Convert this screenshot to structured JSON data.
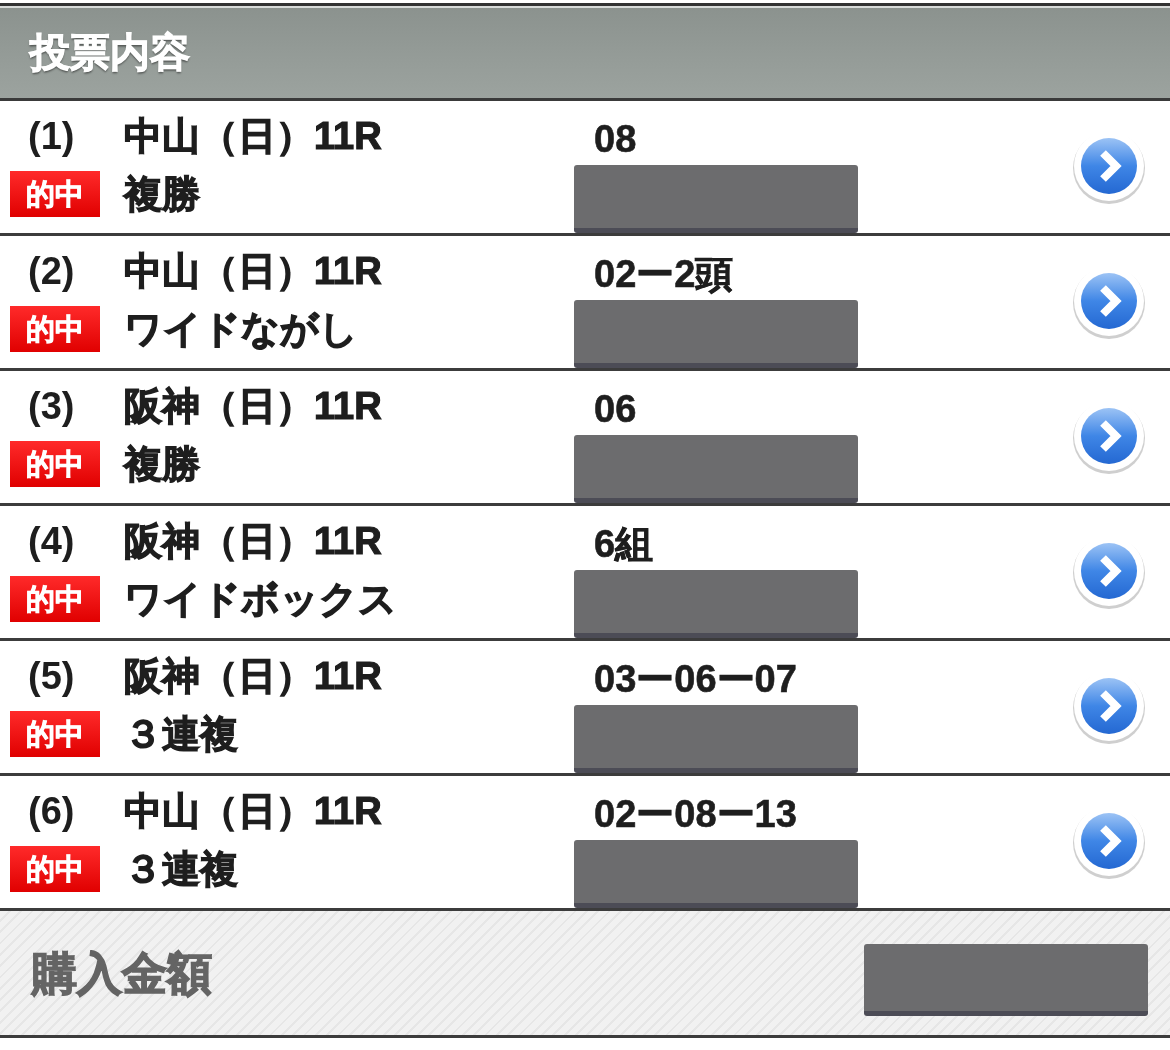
{
  "header": {
    "title": "投票内容"
  },
  "bets": [
    {
      "number": "(1)",
      "race": "中山（日）11R",
      "result": "的中",
      "bet_type": "複勝",
      "selection": "08"
    },
    {
      "number": "(2)",
      "race": "中山（日）11R",
      "result": "的中",
      "bet_type": "ワイドながし",
      "selection": "02ー2頭"
    },
    {
      "number": "(3)",
      "race": "阪神（日）11R",
      "result": "的中",
      "bet_type": "複勝",
      "selection": "06"
    },
    {
      "number": "(4)",
      "race": "阪神（日）11R",
      "result": "的中",
      "bet_type": "ワイドボックス",
      "selection": "6組"
    },
    {
      "number": "(5)",
      "race": "阪神（日）11R",
      "result": "的中",
      "bet_type": "３連複",
      "selection": "03ー06ー07"
    },
    {
      "number": "(6)",
      "race": "中山（日）11R",
      "result": "的中",
      "bet_type": "３連複",
      "selection": "02ー08ー13"
    }
  ],
  "footer": {
    "label": "購入金額"
  }
}
